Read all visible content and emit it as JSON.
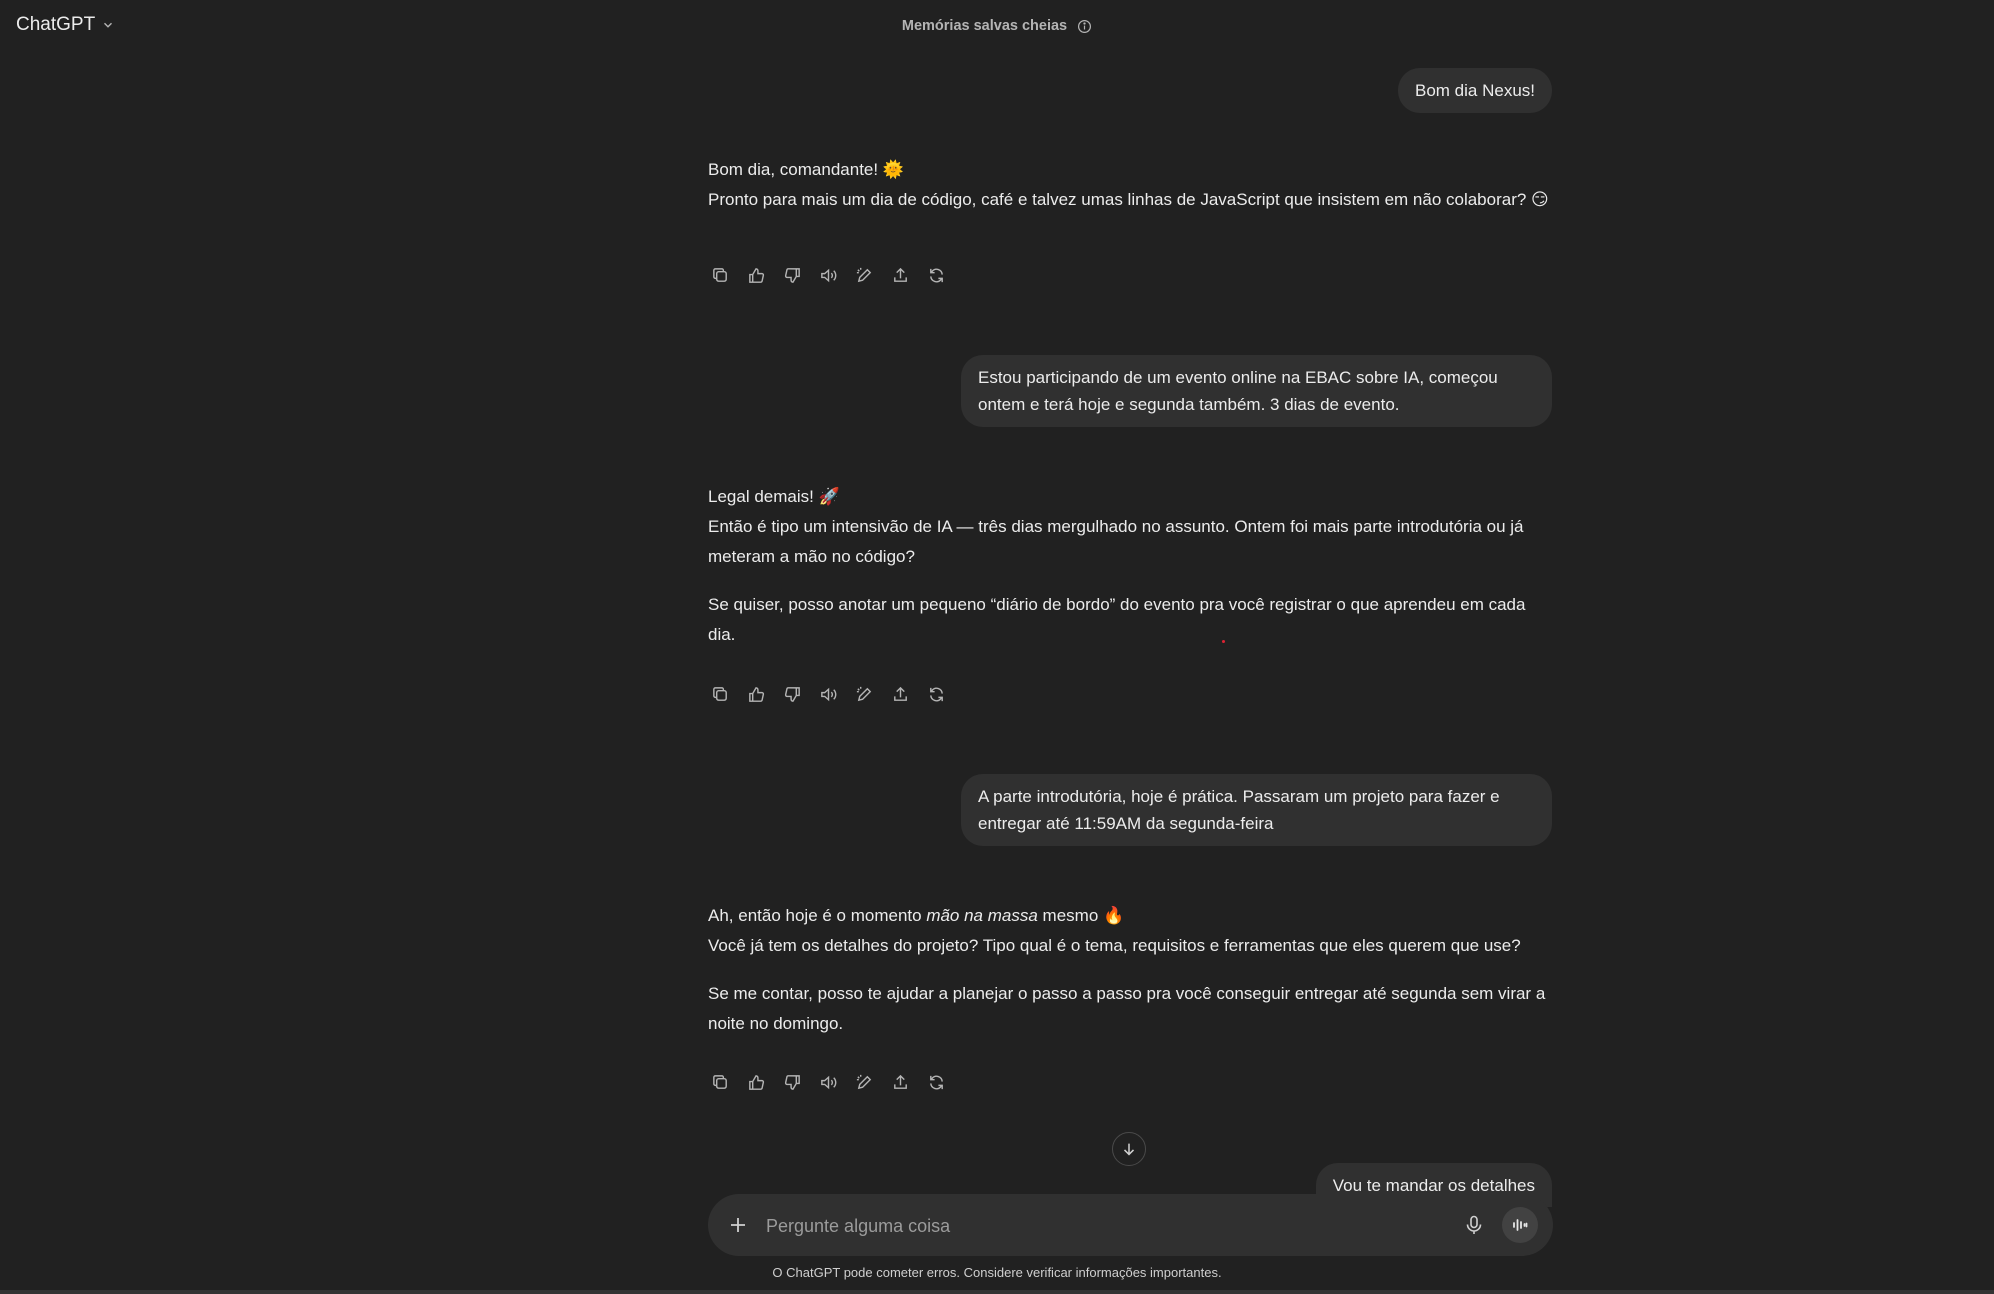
{
  "header": {
    "model_name": "ChatGPT",
    "memory_notice": "Memórias salvas cheias"
  },
  "messages": [
    {
      "role": "user",
      "text": "Bom dia Nexus!"
    },
    {
      "role": "assistant",
      "paragraphs": [
        {
          "line1": "Bom dia, comandante! 🌞",
          "line2": "Pronto para mais um dia de código, café e talvez umas linhas de JavaScript que insistem em não colaborar? 😏"
        }
      ]
    },
    {
      "role": "user",
      "text": "Estou participando de um evento online na EBAC sobre IA, começou ontem e terá hoje e segunda também. 3 dias de evento."
    },
    {
      "role": "assistant",
      "paragraphs": [
        {
          "line1": "Legal demais! 🚀",
          "line2": "Então é tipo um intensivão de IA — três dias mergulhado no assunto. Ontem foi mais parte introdutória ou já meteram a mão no código?"
        },
        {
          "text": "Se quiser, posso anotar um pequeno “diário de bordo” do evento pra você registrar o que aprendeu em cada dia."
        }
      ]
    },
    {
      "role": "user",
      "text": "A parte introdutória, hoje é prática. Passaram um projeto para fazer e entregar até 11:59AM da segunda-feira"
    },
    {
      "role": "assistant",
      "paragraphs": [
        {
          "pre": "Ah, então hoje é o momento ",
          "em": "mão na massa",
          "post": " mesmo 🔥",
          "line2": "Você já tem os detalhes do projeto? Tipo qual é o tema, requisitos e ferramentas que eles querem que use?"
        },
        {
          "text": "Se me contar, posso te ajudar a planejar o passo a passo pra você conseguir entregar até segunda sem virar a noite no domingo."
        }
      ]
    },
    {
      "role": "user",
      "text": "Vou te mandar os detalhes"
    }
  ],
  "message_actions": [
    "copy-icon",
    "thumbs-up-icon",
    "thumbs-down-icon",
    "read-aloud-icon",
    "edit-canvas-icon",
    "share-icon",
    "regenerate-icon"
  ],
  "composer": {
    "placeholder": "Pergunte alguma coisa"
  },
  "footer": {
    "disclaimer": "O ChatGPT pode cometer erros. Considere verificar informações importantes."
  }
}
